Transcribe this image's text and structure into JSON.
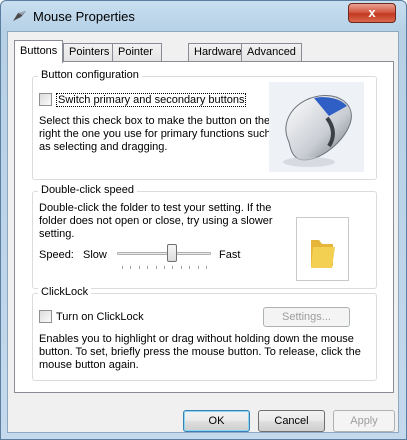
{
  "window": {
    "title": "Mouse Properties",
    "close_label": "x"
  },
  "tabs": [
    {
      "label": "Buttons",
      "active": true
    },
    {
      "label": "Pointers",
      "active": false
    },
    {
      "label": "Pointer Options",
      "active": false
    },
    {
      "label": "Hardware",
      "active": false
    },
    {
      "label": "Advanced",
      "active": false
    }
  ],
  "button_configuration": {
    "title": "Button configuration",
    "checkbox_label": "Switch primary and secondary buttons",
    "checked": false,
    "description_lines": [
      "Select this check box to make the button on the",
      "right the one you use for primary functions such",
      "as selecting and dragging."
    ]
  },
  "double_click": {
    "title": "Double-click speed",
    "description_lines": [
      "Double-click the folder to test your setting. If the",
      "folder does not open or close, try using a slower",
      "setting."
    ],
    "speed_label": "Speed:",
    "slow_label": "Slow",
    "fast_label": "Fast",
    "speed_value": 0.6
  },
  "clicklock": {
    "title": "ClickLock",
    "checkbox_label": "Turn on ClickLock",
    "checked": false,
    "settings_label": "Settings...",
    "description_lines": [
      "Enables you to highlight or drag without holding down the mouse",
      "button. To set, briefly press the mouse button. To release, click the",
      "mouse button again."
    ]
  },
  "footer": {
    "ok_label": "OK",
    "cancel_label": "Cancel",
    "apply_label": "Apply"
  },
  "colors": {
    "close_button": "#c2391f",
    "default_button_border": "#3c7fb1",
    "folder_yellow": "#f3cf52"
  }
}
